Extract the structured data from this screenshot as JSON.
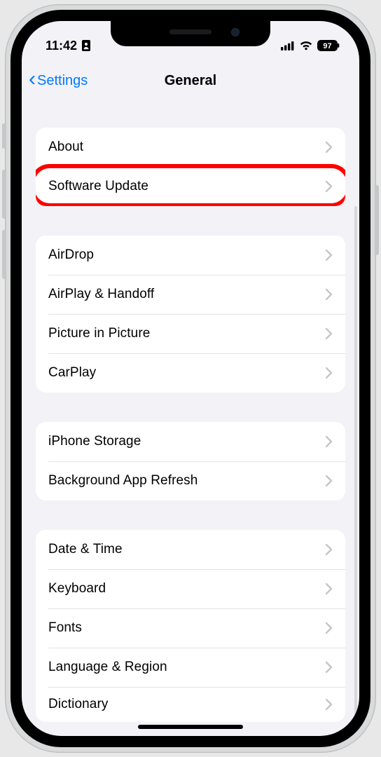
{
  "status": {
    "time": "11:42",
    "battery_pct": "97"
  },
  "nav": {
    "back_label": "Settings",
    "title": "General"
  },
  "groups": [
    {
      "rows": [
        {
          "label": "About"
        },
        {
          "label": "Software Update",
          "highlighted": true
        }
      ]
    },
    {
      "rows": [
        {
          "label": "AirDrop"
        },
        {
          "label": "AirPlay & Handoff"
        },
        {
          "label": "Picture in Picture"
        },
        {
          "label": "CarPlay"
        }
      ]
    },
    {
      "rows": [
        {
          "label": "iPhone Storage"
        },
        {
          "label": "Background App Refresh"
        }
      ]
    },
    {
      "rows": [
        {
          "label": "Date & Time"
        },
        {
          "label": "Keyboard"
        },
        {
          "label": "Fonts"
        },
        {
          "label": "Language & Region"
        },
        {
          "label": "Dictionary"
        }
      ]
    }
  ],
  "highlight_color": "#ff0000",
  "accent_color": "#007aff"
}
